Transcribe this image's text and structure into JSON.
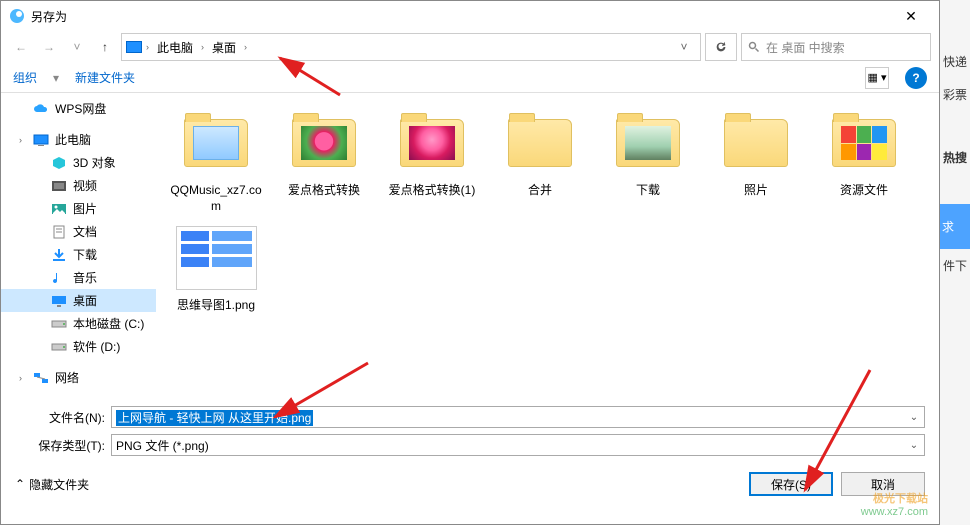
{
  "titlebar": {
    "title": "另存为"
  },
  "nav": {
    "crumbs": [
      "此电脑",
      "桌面"
    ],
    "search_placeholder": "在 桌面 中搜索"
  },
  "toolbar": {
    "organize": "组织",
    "new_folder": "新建文件夹"
  },
  "sidebar": {
    "items": [
      {
        "label": "WPS网盘",
        "type": "cloud"
      },
      {
        "label": "此电脑",
        "type": "pc"
      },
      {
        "label": "3D 对象",
        "type": "3d",
        "sub": true
      },
      {
        "label": "视频",
        "type": "video",
        "sub": true
      },
      {
        "label": "图片",
        "type": "pic",
        "sub": true
      },
      {
        "label": "文档",
        "type": "doc",
        "sub": true
      },
      {
        "label": "下载",
        "type": "down",
        "sub": true
      },
      {
        "label": "音乐",
        "type": "music",
        "sub": true
      },
      {
        "label": "桌面",
        "type": "desktop",
        "sub": true,
        "selected": true
      },
      {
        "label": "本地磁盘 (C:)",
        "type": "disk",
        "sub": true
      },
      {
        "label": "软件 (D:)",
        "type": "disk",
        "sub": true
      },
      {
        "label": "网络",
        "type": "net"
      }
    ]
  },
  "files": [
    {
      "label": "QQMusic_xz7.com",
      "kind": "folder-music"
    },
    {
      "label": "爱点格式转换",
      "kind": "folder-flower"
    },
    {
      "label": "爱点格式转换(1)",
      "kind": "folder-flower2"
    },
    {
      "label": "合并",
      "kind": "folder"
    },
    {
      "label": "下载",
      "kind": "folder-dl"
    },
    {
      "label": "照片",
      "kind": "folder"
    },
    {
      "label": "资源文件",
      "kind": "folder-res"
    },
    {
      "label": "思维导图1.png",
      "kind": "mindmap"
    }
  ],
  "form": {
    "filename_label": "文件名(N):",
    "filename_value": "上网导航 - 轻快上网 从这里开始.png",
    "filetype_label": "保存类型(T):",
    "filetype_value": "PNG 文件 (*.png)"
  },
  "footer": {
    "hide_folders": "隐藏文件夹",
    "save": "保存(S)",
    "cancel": "取消"
  },
  "rightpanel": {
    "items": [
      "快递",
      "彩票",
      "热搜",
      "求",
      "件下"
    ]
  },
  "watermark": {
    "line1": "极光下载站",
    "line2": "www.xz7.com"
  }
}
